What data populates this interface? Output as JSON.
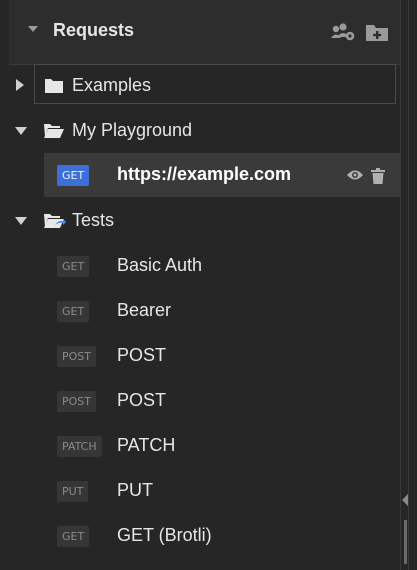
{
  "header": {
    "title": "Requests",
    "icons": [
      "collapse-caret-icon",
      "team-settings-icon",
      "add-folder-icon"
    ]
  },
  "folders": [
    {
      "name": "Examples",
      "expanded": false,
      "icon": "folder-closed-icon"
    },
    {
      "name": "My Playground",
      "expanded": true,
      "icon": "folder-open-icon"
    },
    {
      "name": "Tests",
      "expanded": true,
      "icon": "folder-open-shared-icon"
    }
  ],
  "requests": [
    {
      "method": "GET",
      "label": "https://example.com",
      "active": true
    },
    {
      "method": "GET",
      "label": "Basic Auth"
    },
    {
      "method": "GET",
      "label": "Bearer"
    },
    {
      "method": "POST",
      "label": "POST"
    },
    {
      "method": "POST",
      "label": "POST"
    },
    {
      "method": "PATCH",
      "label": "PATCH"
    },
    {
      "method": "PUT",
      "label": "PUT"
    },
    {
      "method": "GET",
      "label": "GET (Brotli)"
    }
  ],
  "colors": {
    "background": "#262626",
    "active_row": "#3a3a3a",
    "get_active_badge": "#3c6fd8",
    "accent_blue": "#4a8cff"
  }
}
